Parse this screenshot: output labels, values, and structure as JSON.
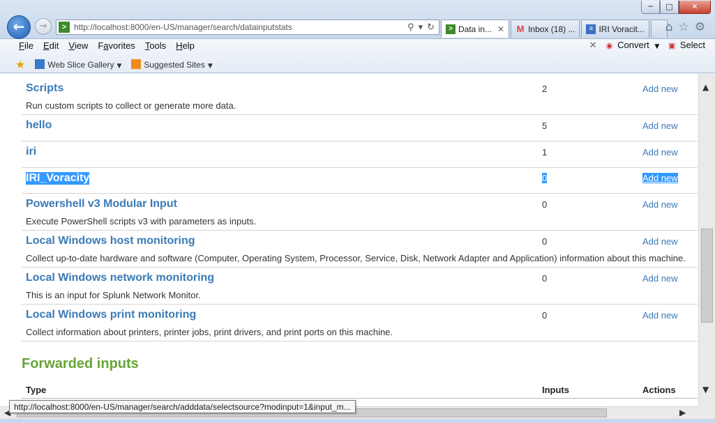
{
  "browser": {
    "address": "http://localhost:8000/en-US/manager/search/datainputstats",
    "tabs": [
      {
        "label": "Data in...",
        "active": true
      },
      {
        "label": "Inbox (18) ...",
        "active": false
      },
      {
        "label": "IRI Voracit...",
        "active": false
      }
    ],
    "window_buttons": {
      "minimize": "─",
      "maximize": "□",
      "close": "✕"
    }
  },
  "menu": {
    "items": [
      {
        "acc": "F",
        "rest": "ile"
      },
      {
        "acc": "E",
        "rest": "dit"
      },
      {
        "acc": "V",
        "rest": "iew"
      },
      {
        "acc": "",
        "rest": "Favorites",
        "acc_index": 1
      },
      {
        "acc": "T",
        "rest": "ools"
      },
      {
        "acc": "H",
        "rest": "elp"
      }
    ],
    "convert_label": "Convert",
    "select_label": "Select"
  },
  "favorites": {
    "web_slice": "Web Slice Gallery",
    "suggested": "Suggested Sites"
  },
  "inputs": [
    {
      "title": "Scripts",
      "desc": "Run custom scripts to collect or generate more data.",
      "count": "2",
      "action": "Add new",
      "selected": false
    },
    {
      "title": "hello",
      "desc": "",
      "count": "5",
      "action": "Add new",
      "selected": false
    },
    {
      "title": "iri",
      "desc": "",
      "count": "1",
      "action": "Add new",
      "selected": false
    },
    {
      "title": "IRI_Voracity",
      "desc": "",
      "count": "0",
      "action": "Add new",
      "selected": true
    },
    {
      "title": "Powershell v3 Modular Input",
      "desc": "Execute PowerShell scripts v3 with parameters as inputs.",
      "count": "0",
      "action": "Add new",
      "selected": false
    },
    {
      "title": "Local Windows host monitoring",
      "desc": "Collect up-to-date hardware and software (Computer, Operating System, Processor, Service, Disk, Network Adapter and Application) information about this machine.",
      "count": "0",
      "action": "Add new",
      "selected": false
    },
    {
      "title": "Local Windows network monitoring",
      "desc": "This is an input for Splunk Network Monitor.",
      "count": "0",
      "action": "Add new",
      "selected": false
    },
    {
      "title": "Local Windows print monitoring",
      "desc": "Collect information about printers, printer jobs, print drivers, and print ports on this machine.",
      "count": "0",
      "action": "Add new",
      "selected": false
    }
  ],
  "forwarded": {
    "heading": "Forwarded inputs",
    "col_type": "Type",
    "col_inputs": "Inputs",
    "col_actions": "Actions"
  },
  "status_url": "http://localhost:8000/en-US/manager/search/adddata/selectsource?modinput=1&input_m..."
}
